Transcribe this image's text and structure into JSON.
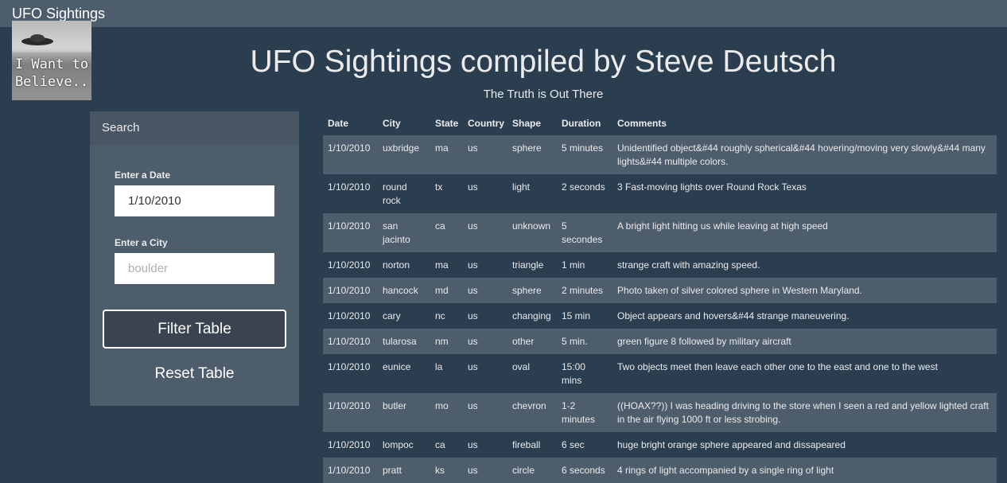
{
  "navbar": {
    "brand": "UFO Sightings"
  },
  "logo": {
    "line1": "I Want to",
    "line2": "Believe.."
  },
  "header": {
    "title": "UFO Sightings compiled by Steve Deutsch",
    "subtitle": "The Truth is Out There"
  },
  "search": {
    "heading": "Search",
    "date_label": "Enter a Date",
    "date_value": "1/10/2010",
    "city_label": "Enter a City",
    "city_placeholder": "boulder",
    "filter_button": "Filter Table",
    "reset_button": "Reset Table"
  },
  "table": {
    "columns": [
      "Date",
      "City",
      "State",
      "Country",
      "Shape",
      "Duration",
      "Comments"
    ],
    "rows": [
      [
        "1/10/2010",
        "uxbridge",
        "ma",
        "us",
        "sphere",
        "5 minutes",
        "Unidentified object&#44 roughly spherical&#44 hovering/moving very slowly&#44 many lights&#44 multiple colors."
      ],
      [
        "1/10/2010",
        "round rock",
        "tx",
        "us",
        "light",
        "2 seconds",
        "3 Fast-moving lights over Round Rock Texas"
      ],
      [
        "1/10/2010",
        "san jacinto",
        "ca",
        "us",
        "unknown",
        "5 secondes",
        "A bright light hitting us while leaving at high speed"
      ],
      [
        "1/10/2010",
        "norton",
        "ma",
        "us",
        "triangle",
        "1 min",
        "strange craft with amazing speed."
      ],
      [
        "1/10/2010",
        "hancock",
        "md",
        "us",
        "sphere",
        "2 minutes",
        "Photo taken of silver colored sphere in Western Maryland."
      ],
      [
        "1/10/2010",
        "cary",
        "nc",
        "us",
        "changing",
        "15 min",
        "Object appears and hovers&#44 strange maneuvering."
      ],
      [
        "1/10/2010",
        "tularosa",
        "nm",
        "us",
        "other",
        "5 min.",
        "green figure 8 followed by military aircraft"
      ],
      [
        "1/10/2010",
        "eunice",
        "la",
        "us",
        "oval",
        "15:00 mins",
        "Two objects meet then leave each other one to the east and one to the west"
      ],
      [
        "1/10/2010",
        "butler",
        "mo",
        "us",
        "chevron",
        "1-2 minutes",
        "((HOAX??)) I was heading driving to the store when I seen a red and yellow lighted craft in the air flying 1000 ft or less strobing."
      ],
      [
        "1/10/2010",
        "lompoc",
        "ca",
        "us",
        "fireball",
        "6 sec",
        "huge bright orange sphere appeared and dissapeared"
      ],
      [
        "1/10/2010",
        "pratt",
        "ks",
        "us",
        "circle",
        "6 seconds",
        "4 rings of light accompanied by a single ring of light"
      ]
    ]
  }
}
